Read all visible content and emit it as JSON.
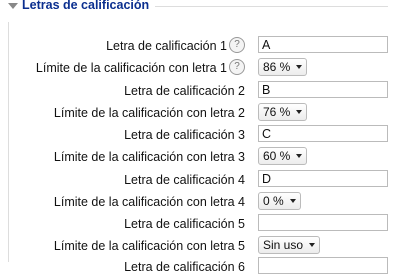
{
  "section": {
    "title": "Letras de calificación"
  },
  "rows": [
    {
      "type": "letter",
      "label": "Letra de calificación 1",
      "value": "A",
      "help": true
    },
    {
      "type": "limit",
      "label": "Límite de la calificación con letra 1",
      "value": "86 %",
      "help": true
    },
    {
      "type": "letter",
      "label": "Letra de calificación 2",
      "value": "B"
    },
    {
      "type": "limit",
      "label": "Límite de la calificación con letra 2",
      "value": "76 %"
    },
    {
      "type": "letter",
      "label": "Letra de calificación 3",
      "value": "C"
    },
    {
      "type": "limit",
      "label": "Límite de la calificación con letra 3",
      "value": "60 %"
    },
    {
      "type": "letter",
      "label": "Letra de calificación 4",
      "value": "D"
    },
    {
      "type": "limit",
      "label": "Límite de la calificación con letra 4",
      "value": "0 %"
    },
    {
      "type": "letter",
      "label": "Letra de calificación 5",
      "value": ""
    },
    {
      "type": "limit",
      "label": "Límite de la calificación con letra 5",
      "value": "Sin uso"
    },
    {
      "type": "letter",
      "label": "Letra de calificación 6",
      "value": ""
    }
  ],
  "icons": {
    "help": "question-mark-circle-icon",
    "collapse": "triangle-down-icon",
    "dropdown": "caret-down-icon"
  },
  "help_glyph": "?"
}
